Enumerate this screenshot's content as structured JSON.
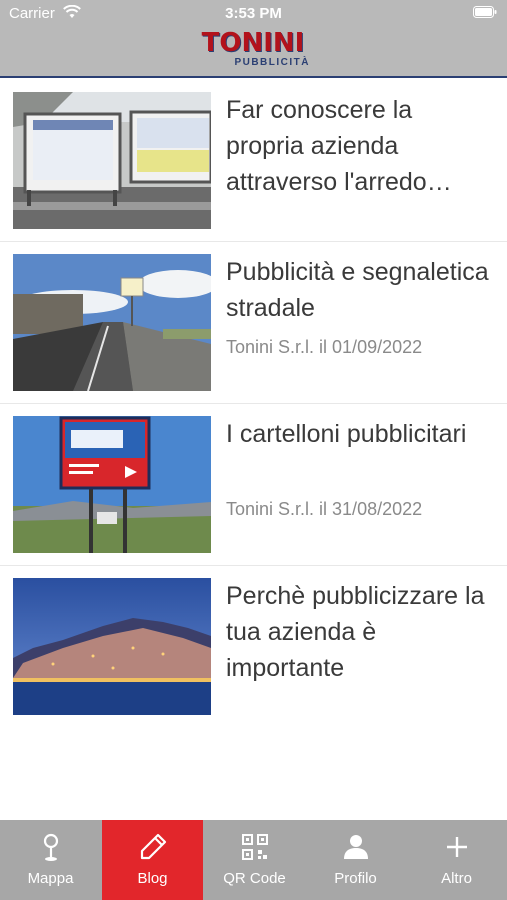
{
  "status_bar": {
    "carrier": "Carrier",
    "time": "3:53 PM"
  },
  "header": {
    "logo_main": "TONINI",
    "logo_sub": "PUBBLICITÀ"
  },
  "articles": [
    {
      "title": "Far conoscere la propria azienda attraverso l'arredo…",
      "meta": ""
    },
    {
      "title": "Pubblicità e segnaletica stradale",
      "meta": "Tonini S.r.l. il 01/09/2022"
    },
    {
      "title": "I cartelloni pubblicitari",
      "meta": "Tonini S.r.l. il 31/08/2022"
    },
    {
      "title": "Perchè pubblicizzare la tua azienda è importante",
      "meta": ""
    }
  ],
  "tabs": [
    {
      "label": "Mappa",
      "icon": "map-pin-icon",
      "active": false
    },
    {
      "label": "Blog",
      "icon": "pencil-icon",
      "active": true
    },
    {
      "label": "QR Code",
      "icon": "qr-code-icon",
      "active": false
    },
    {
      "label": "Profilo",
      "icon": "person-icon",
      "active": false
    },
    {
      "label": "Altro",
      "icon": "plus-icon",
      "active": false
    }
  ],
  "colors": {
    "header_bg": "#b9b9b9",
    "tabbar_bg": "#a7a7a7",
    "active_tab": "#e2262b",
    "brand_red": "#b3121b",
    "brand_blue": "#2b3f73"
  }
}
